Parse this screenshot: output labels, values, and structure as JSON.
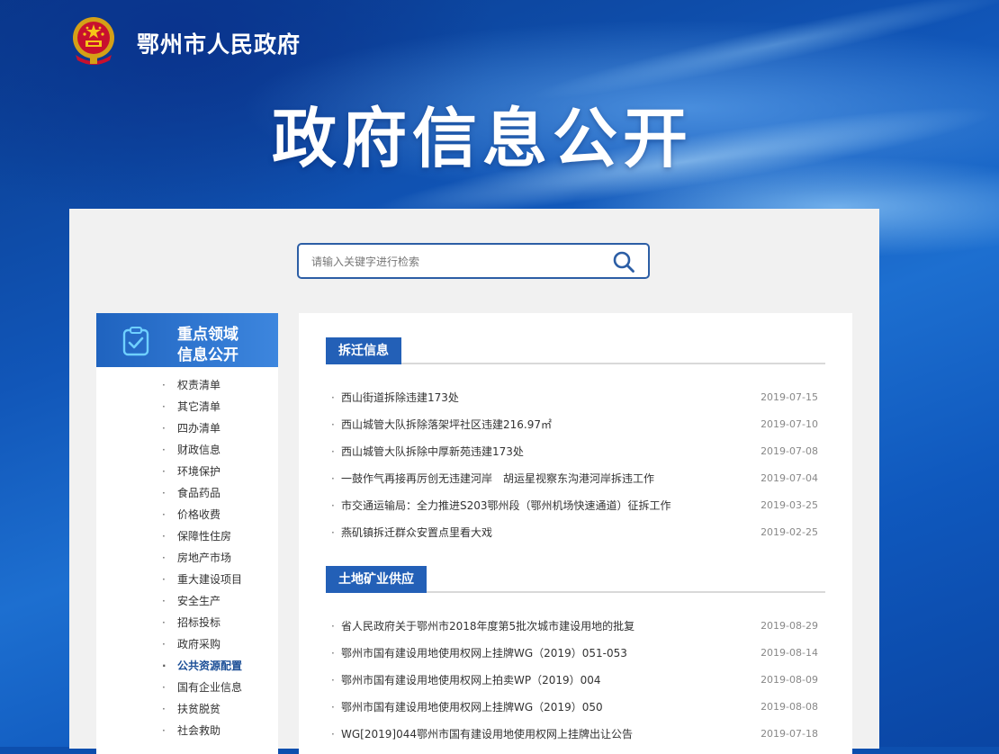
{
  "header": {
    "site_name": "鄂州市人民政府",
    "banner_title": "政府信息公开"
  },
  "search": {
    "placeholder": "请输入关键字进行检索",
    "icon": "search-icon"
  },
  "sidebar": {
    "heading_line1": "重点领域",
    "heading_line2": "信息公开",
    "heading_icon": "clipboard-check-icon",
    "items": [
      {
        "label": "权责清单"
      },
      {
        "label": "其它清单"
      },
      {
        "label": "四办清单"
      },
      {
        "label": "财政信息"
      },
      {
        "label": "环境保护"
      },
      {
        "label": "食品药品"
      },
      {
        "label": "价格收费"
      },
      {
        "label": "保障性住房"
      },
      {
        "label": "房地产市场"
      },
      {
        "label": "重大建设项目"
      },
      {
        "label": "安全生产"
      },
      {
        "label": "招标投标"
      },
      {
        "label": "政府采购"
      },
      {
        "label": "公共资源配置",
        "active": true
      },
      {
        "label": "国有企业信息"
      },
      {
        "label": "扶贫脱贫"
      },
      {
        "label": "社会救助"
      }
    ]
  },
  "sections": [
    {
      "title": "拆迁信息",
      "items": [
        {
          "title": "西山街道拆除违建173处",
          "date": "2019-07-15"
        },
        {
          "title": "西山城管大队拆除落架坪社区违建216.97㎡",
          "date": "2019-07-10"
        },
        {
          "title": "西山城管大队拆除中厚新苑违建173处",
          "date": "2019-07-08"
        },
        {
          "title": "一鼓作气再接再厉创无违建河岸　胡运星视察东沟港河岸拆违工作",
          "date": "2019-07-04"
        },
        {
          "title": "市交通运输局：全力推进S203鄂州段（鄂州机场快速通道）征拆工作",
          "date": "2019-03-25"
        },
        {
          "title": "燕矶镇拆迁群众安置点里看大戏",
          "date": "2019-02-25"
        }
      ]
    },
    {
      "title": "土地矿业供应",
      "items": [
        {
          "title": "省人民政府关于鄂州市2018年度第5批次城市建设用地的批复",
          "date": "2019-08-29"
        },
        {
          "title": "鄂州市国有建设用地使用权网上挂牌WG（2019）051-053",
          "date": "2019-08-14"
        },
        {
          "title": "鄂州市国有建设用地使用权网上拍卖WP（2019）004",
          "date": "2019-08-09"
        },
        {
          "title": "鄂州市国有建设用地使用权网上挂牌WG（2019）050",
          "date": "2019-08-08"
        },
        {
          "title": "WG[2019]044鄂州市国有建设用地使用权网上挂牌出让公告",
          "date": "2019-07-18"
        }
      ]
    }
  ],
  "colors": {
    "accent": "#2360b7",
    "active_link": "#1c4f97"
  }
}
